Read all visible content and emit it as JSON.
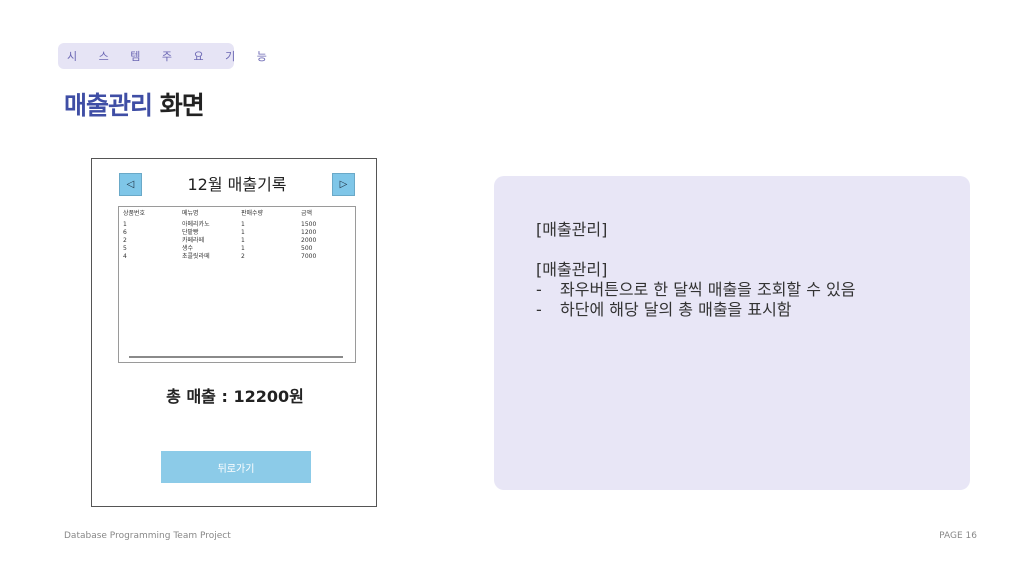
{
  "tag": "시 스 템 주 요 기 능",
  "title": {
    "accent": "매출관리",
    "rest": " 화면"
  },
  "window": {
    "prev_icon": "◁",
    "next_icon": "▷",
    "month_title": "12월 매출기록",
    "table": {
      "headers": [
        "상품번호",
        "메뉴명",
        "판매수량",
        "금액"
      ],
      "rows": [
        [
          "1",
          "아메리카노",
          "1",
          "1500"
        ],
        [
          "6",
          "단팥빵",
          "1",
          "1200"
        ],
        [
          "2",
          "카페라떼",
          "1",
          "2000"
        ],
        [
          "5",
          "생수",
          "1",
          "500"
        ],
        [
          "4",
          "초콜릿라떼",
          "2",
          "7000"
        ]
      ]
    },
    "total": "총 매출 : 12200원",
    "back_button": "뒤로가기"
  },
  "panel": {
    "heading1": "[매출관리]",
    "heading2": "[매출관리]",
    "bullet_mark": "-",
    "bullets": [
      "좌우버튼으로 한 달씩 매출을 조회할 수 있음",
      "하단에 해당 달의 총 매출을 표시함"
    ]
  },
  "footer": {
    "left": "Database Programming Team Project",
    "right": "PAGE 16"
  },
  "colors": {
    "accent": "#3f4ea5",
    "tag_bg": "#e6e4f5",
    "panel_bg": "#e8e6f6",
    "nav_button": "#7fc6e8",
    "back_button": "#8ccbe8"
  }
}
